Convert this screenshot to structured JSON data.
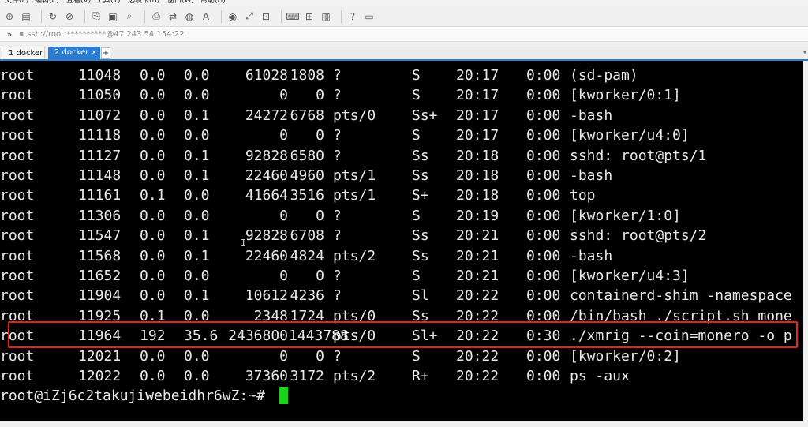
{
  "menu": [
    "文件(F)",
    "编辑(E)",
    "查看(V)",
    "工具(T)",
    "选项卡(B)",
    "窗口(W)",
    "帮助(H)"
  ],
  "address": {
    "prefix_icon": "lock-icon",
    "text": "ssh://root:**********@47.243.54.154:22",
    "chevron": "»"
  },
  "tabs": [
    {
      "label": "1 docker",
      "active": false
    },
    {
      "label": "2 docker",
      "active": true
    }
  ],
  "tab_add_label": "+",
  "tab_close_label": "×",
  "processes": [
    {
      "user": "root",
      "pid": "11048",
      "cpu": "0.0",
      "mem": "0.0",
      "vsz": "61028",
      "rss": "1808",
      "tty": "?",
      "stat": "S",
      "start": "20:17",
      "time": "0:00",
      "cmd": "(sd-pam)"
    },
    {
      "user": "root",
      "pid": "11050",
      "cpu": "0.0",
      "mem": "0.0",
      "vsz": "0",
      "rss": "0",
      "tty": "?",
      "stat": "S",
      "start": "20:17",
      "time": "0:00",
      "cmd": "[kworker/0:1]"
    },
    {
      "user": "root",
      "pid": "11072",
      "cpu": "0.0",
      "mem": "0.1",
      "vsz": "24272",
      "rss": "6768",
      "tty": "pts/0",
      "stat": "Ss+",
      "start": "20:17",
      "time": "0:00",
      "cmd": "-bash"
    },
    {
      "user": "root",
      "pid": "11118",
      "cpu": "0.0",
      "mem": "0.0",
      "vsz": "0",
      "rss": "0",
      "tty": "?",
      "stat": "S",
      "start": "20:17",
      "time": "0:00",
      "cmd": "[kworker/u4:0]"
    },
    {
      "user": "root",
      "pid": "11127",
      "cpu": "0.0",
      "mem": "0.1",
      "vsz": "92828",
      "rss": "6580",
      "tty": "?",
      "stat": "Ss",
      "start": "20:18",
      "time": "0:00",
      "cmd": "sshd: root@pts/1"
    },
    {
      "user": "root",
      "pid": "11148",
      "cpu": "0.0",
      "mem": "0.1",
      "vsz": "22460",
      "rss": "4960",
      "tty": "pts/1",
      "stat": "Ss",
      "start": "20:18",
      "time": "0:00",
      "cmd": "-bash"
    },
    {
      "user": "root",
      "pid": "11161",
      "cpu": "0.1",
      "mem": "0.0",
      "vsz": "41664",
      "rss": "3516",
      "tty": "pts/1",
      "stat": "S+",
      "start": "20:18",
      "time": "0:00",
      "cmd": "top"
    },
    {
      "user": "root",
      "pid": "11306",
      "cpu": "0.0",
      "mem": "0.0",
      "vsz": "0",
      "rss": "0",
      "tty": "?",
      "stat": "S",
      "start": "20:19",
      "time": "0:00",
      "cmd": "[kworker/1:0]"
    },
    {
      "user": "root",
      "pid": "11547",
      "cpu": "0.0",
      "mem": "0.1",
      "vsz": "92828",
      "rss": "6708",
      "tty": "?",
      "stat": "Ss",
      "start": "20:21",
      "time": "0:00",
      "cmd": "sshd: root@pts/2"
    },
    {
      "user": "root",
      "pid": "11568",
      "cpu": "0.0",
      "mem": "0.1",
      "vsz": "22460",
      "rss": "4824",
      "tty": "pts/2",
      "stat": "Ss",
      "start": "20:21",
      "time": "0:00",
      "cmd": "-bash"
    },
    {
      "user": "root",
      "pid": "11652",
      "cpu": "0.0",
      "mem": "0.0",
      "vsz": "0",
      "rss": "0",
      "tty": "?",
      "stat": "S",
      "start": "20:21",
      "time": "0:00",
      "cmd": "[kworker/u4:3]"
    },
    {
      "user": "root",
      "pid": "11904",
      "cpu": "0.0",
      "mem": "0.1",
      "vsz": "10612",
      "rss": "4236",
      "tty": "?",
      "stat": "Sl",
      "start": "20:22",
      "time": "0:00",
      "cmd": "containerd-shim -namespace"
    },
    {
      "user": "root",
      "pid": "11925",
      "cpu": "0.1",
      "mem": "0.0",
      "vsz": "2348",
      "rss": "1724",
      "tty": "pts/0",
      "stat": "Ss",
      "start": "20:22",
      "time": "0:00",
      "cmd": "/bin/bash ./script.sh mone"
    },
    {
      "user": "root",
      "pid": "11964",
      "cpu": "192",
      "mem": "35.6",
      "vsz": "2436800",
      "rss": "1443788",
      "tty": "pts/0",
      "stat": "Sl+",
      "start": "20:22",
      "time": "0:30",
      "cmd": "./xmrig --coin=monero -o p"
    },
    {
      "user": "root",
      "pid": "12021",
      "cpu": "0.0",
      "mem": "0.0",
      "vsz": "0",
      "rss": "0",
      "tty": "?",
      "stat": "S",
      "start": "20:22",
      "time": "0:00",
      "cmd": "[kworker/0:2]"
    },
    {
      "user": "root",
      "pid": "12022",
      "cpu": "0.0",
      "mem": "0.0",
      "vsz": "37360",
      "rss": "3172",
      "tty": "pts/2",
      "stat": "R+",
      "start": "20:22",
      "time": "0:00",
      "cmd": "ps -aux"
    }
  ],
  "prompt": "root@iZj6c2takujiwebeidhr6wZ:~#",
  "colors": {
    "terminal_bg": "#000000",
    "terminal_fg": "#e8e8e8",
    "cursor": "#18d418",
    "highlight_border": "#e0261b",
    "active_tab": "#2b7cd3"
  },
  "toolbar_icons": [
    "new-session-icon",
    "open-folder-icon",
    "reconnect-icon",
    "disconnect-icon",
    "copy-icon",
    "paste-icon",
    "find-icon",
    "print-icon",
    "transfer-icon",
    "globe-icon",
    "font-icon",
    "script-icon",
    "fullscreen-icon",
    "lock-icon",
    "keyboard-icon",
    "add-pane-icon",
    "layout-icon",
    "help-icon",
    "chat-icon"
  ]
}
